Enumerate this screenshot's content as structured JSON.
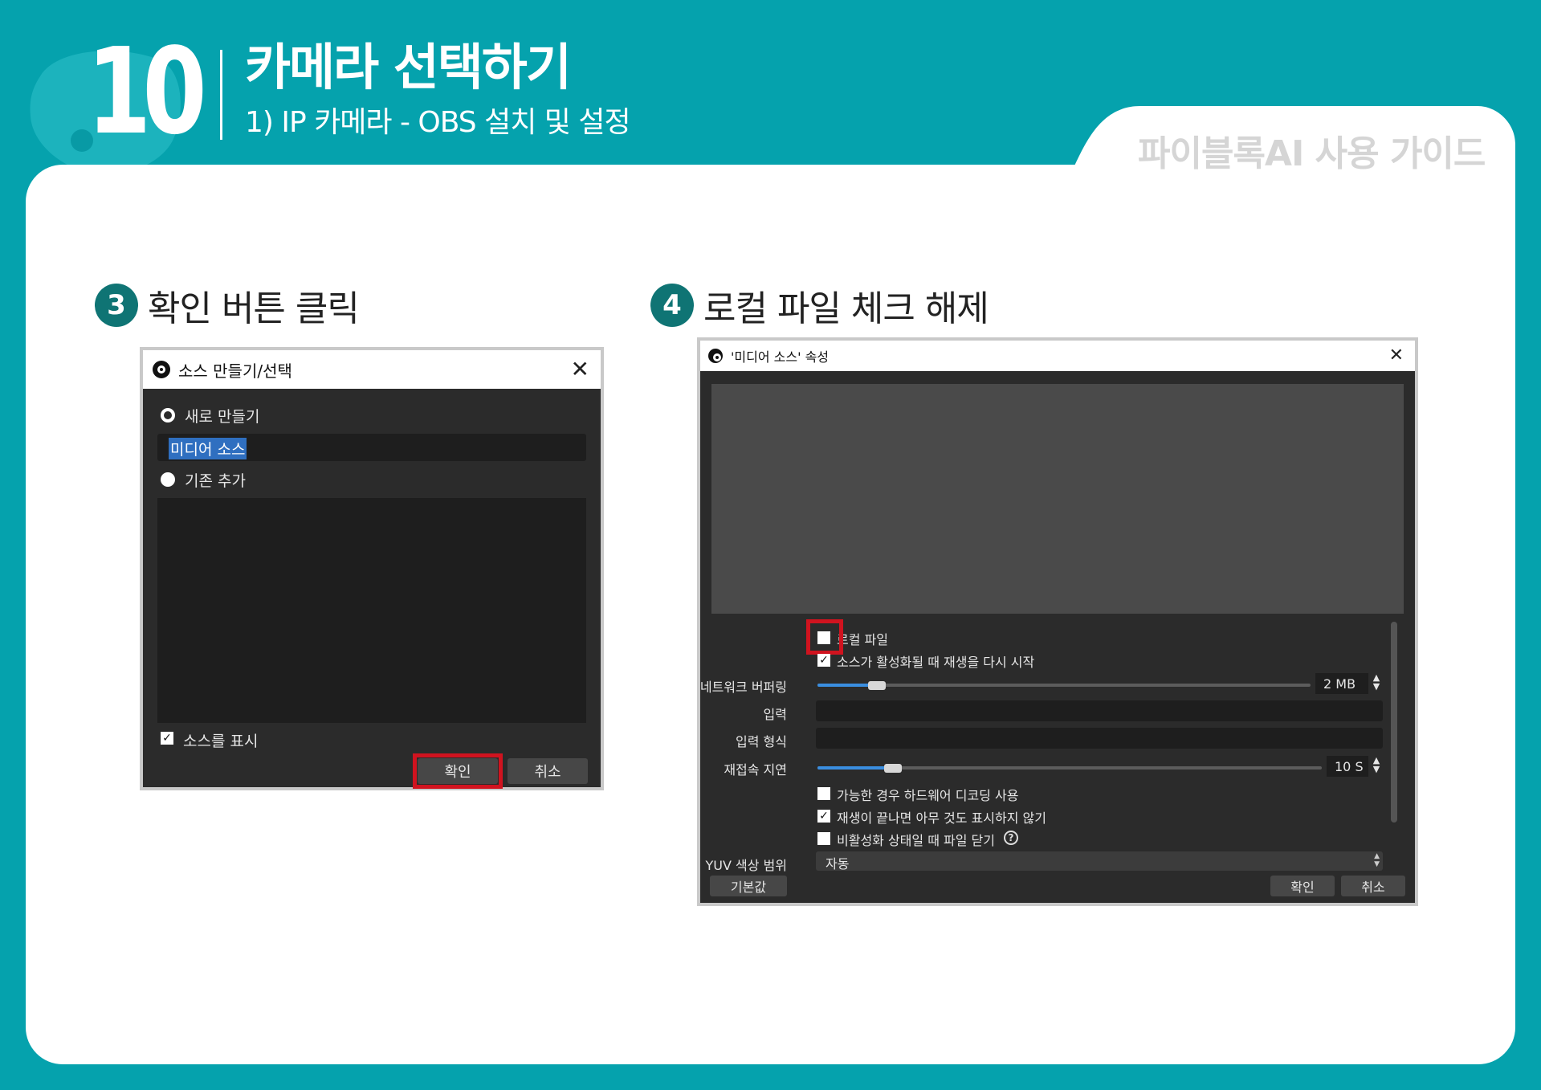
{
  "header": {
    "chapter_number": "10",
    "title": "카메라 선택하기",
    "subtitle": "1) IP 카메라 - OBS 설치 및 설정",
    "guide_label": "파이블록AI 사용 가이드"
  },
  "steps": [
    {
      "number": "3",
      "text": "확인 버튼 클릭"
    },
    {
      "number": "4",
      "text": "로컬 파일 체크 해제"
    }
  ],
  "dialog1": {
    "title": "소스 만들기/선택",
    "radio_new": "새로 만들기",
    "name_value": "미디어 소스",
    "radio_existing": "기존 추가",
    "show_source": "소스를 표시",
    "ok": "확인",
    "cancel": "취소"
  },
  "dialog2": {
    "title": "'미디어 소스' 속성",
    "local_file": "로컬 파일",
    "restart_on_active": "소스가 활성화될 때 재생을 다시 시작",
    "network_buffering": "네트워크 버퍼링",
    "network_buffering_value": "2 MB",
    "network_buffering_level": 0.12,
    "input": "입력",
    "input_format": "입력 형식",
    "reconnect_delay": "재접속 지연",
    "reconnect_delay_value": "10 S",
    "reconnect_delay_level": 0.15,
    "hw_decoding": "가능한 경우 하드웨어 디코딩 사용",
    "show_nothing_on_end": "재생이 끝나면 아무 것도 표시하지 않기",
    "close_when_inactive": "비활성화 상태일 때 파일 닫기",
    "help_glyph": "?",
    "yuv_range": "YUV 색상 범위",
    "yuv_value": "자동",
    "defaults": "기본값",
    "ok": "확인",
    "cancel": "취소"
  }
}
